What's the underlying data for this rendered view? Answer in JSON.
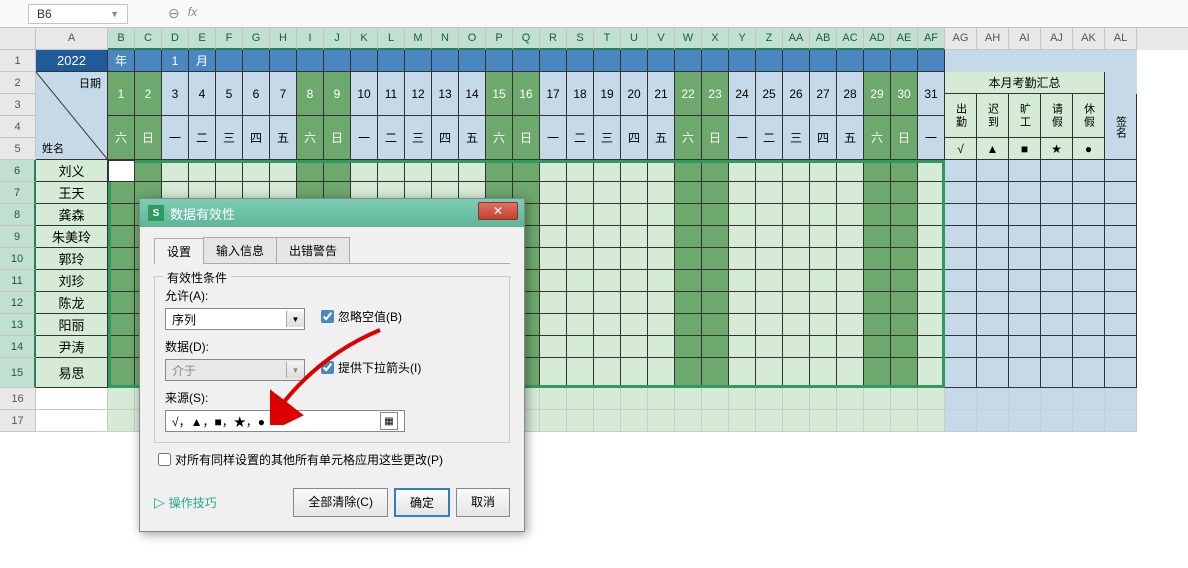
{
  "formula_bar": {
    "cell_ref": "B6",
    "fx": "fx"
  },
  "columns": [
    "A",
    "B",
    "C",
    "D",
    "E",
    "F",
    "G",
    "H",
    "I",
    "J",
    "K",
    "L",
    "M",
    "N",
    "O",
    "P",
    "Q",
    "R",
    "S",
    "T",
    "U",
    "V",
    "W",
    "X",
    "Y",
    "Z",
    "AA",
    "AB",
    "AC",
    "AD",
    "AE",
    "AF",
    "AG",
    "AH",
    "AI",
    "AJ",
    "AK",
    "AL"
  ],
  "rows": [
    1,
    2,
    3,
    4,
    5,
    6,
    7,
    8,
    9,
    10,
    11,
    12,
    13,
    14,
    15,
    16,
    17
  ],
  "year": "2022",
  "year_label": "年",
  "month": "1",
  "month_label": "月",
  "diag_top": "日期",
  "diag_bot": "姓名",
  "days": [
    1,
    2,
    3,
    4,
    5,
    6,
    7,
    8,
    9,
    10,
    11,
    12,
    13,
    14,
    15,
    16,
    17,
    18,
    19,
    20,
    21,
    22,
    23,
    24,
    25,
    26,
    27,
    28,
    29,
    30,
    31
  ],
  "weekdays": [
    "六",
    "日",
    "一",
    "二",
    "三",
    "四",
    "五",
    "六",
    "日",
    "一",
    "二",
    "三",
    "四",
    "五",
    "六",
    "日",
    "一",
    "二",
    "三",
    "四",
    "五",
    "六",
    "日",
    "一",
    "二",
    "三",
    "四",
    "五",
    "六",
    "日",
    "一"
  ],
  "weekend_cols": [
    1,
    2,
    8,
    9,
    15,
    16,
    22,
    23,
    29,
    30
  ],
  "summary_title": "本月考勤汇总",
  "summary": [
    {
      "h": "出勤",
      "s": "√"
    },
    {
      "h": "迟到",
      "s": "▲"
    },
    {
      "h": "旷工",
      "s": "■"
    },
    {
      "h": "请假",
      "s": "★"
    },
    {
      "h": "休假",
      "s": "●"
    }
  ],
  "sign_label": "签名",
  "names": [
    "刘义",
    "王天",
    "龚森",
    "朱美玲",
    "郭玲",
    "刘珍",
    "陈龙",
    "阳丽",
    "尹涛",
    "易思"
  ],
  "dialog": {
    "title": "数据有效性",
    "tabs": [
      "设置",
      "输入信息",
      "出错警告"
    ],
    "group_label": "有效性条件",
    "allow_label": "允许(A):",
    "allow_value": "序列",
    "data_label": "数据(D):",
    "data_value": "介于",
    "source_label": "来源(S):",
    "source_value": "√，▲，■，★，●",
    "ignore_blank": "忽略空值(B)",
    "dropdown_arrow": "提供下拉箭头(I)",
    "apply_all": "对所有同样设置的其他所有单元格应用这些更改(P)",
    "tips": "操作技巧",
    "clear_all": "全部清除(C)",
    "ok": "确定",
    "cancel": "取消"
  }
}
